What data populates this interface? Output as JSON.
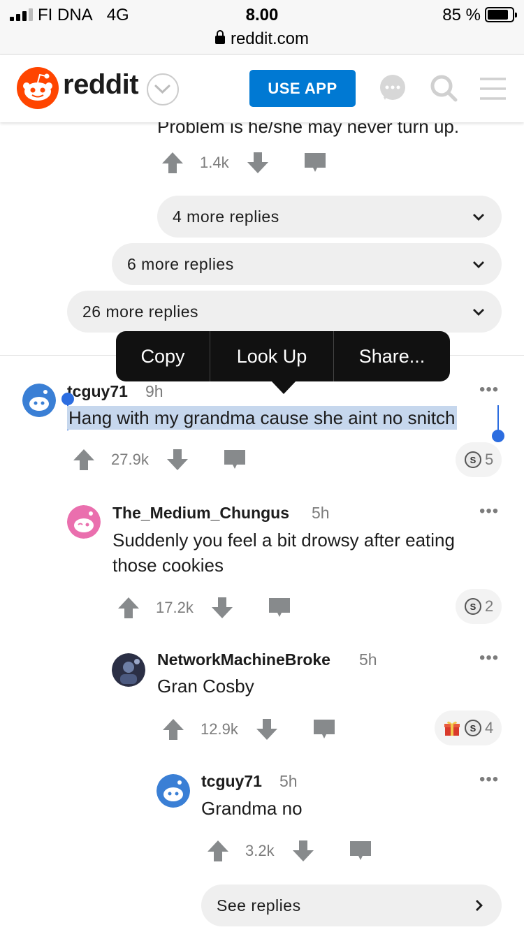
{
  "status_bar": {
    "carrier": "FI DNA",
    "network": "4G",
    "time": "8.00",
    "url": "reddit.com",
    "battery": "85 %",
    "battery_level": 0.85
  },
  "header": {
    "wordmark": "reddit",
    "use_app_label": "USE APP",
    "brand_color": "#ff4500",
    "accent_color": "#0079d3",
    "icons": [
      "snoo-logo",
      "chevron-down-icon",
      "chat-icon",
      "search-icon",
      "hamburger-menu-icon"
    ]
  },
  "previous_comment": {
    "partial_text": "Problem is he/she may never turn up.",
    "score": "1.4k"
  },
  "more_replies": [
    {
      "label": "4 more replies"
    },
    {
      "label": "6 more replies"
    },
    {
      "label": "26 more replies"
    }
  ],
  "context_menu": {
    "items": [
      "Copy",
      "Look Up",
      "Share..."
    ]
  },
  "comments": [
    {
      "username": "tcguy71",
      "age": "9h",
      "body": "Hang with my grandma cause she aint no snitch",
      "score": "27.9k",
      "awards_count": "5",
      "selected": true
    },
    {
      "username": "The_Medium_Chungus",
      "age": "5h",
      "body": "Suddenly you feel a bit drowsy after eating those cookies",
      "score": "17.2k",
      "awards_count": "2"
    },
    {
      "username": "NetworkMachineBroke",
      "age": "5h",
      "body": "Gran Cosby",
      "score": "12.9k",
      "awards_count": "4"
    },
    {
      "username": "tcguy71",
      "age": "5h",
      "body": "Grandma no",
      "score": "3.2k"
    }
  ],
  "see_replies_label": "See replies",
  "more_options": "•••"
}
